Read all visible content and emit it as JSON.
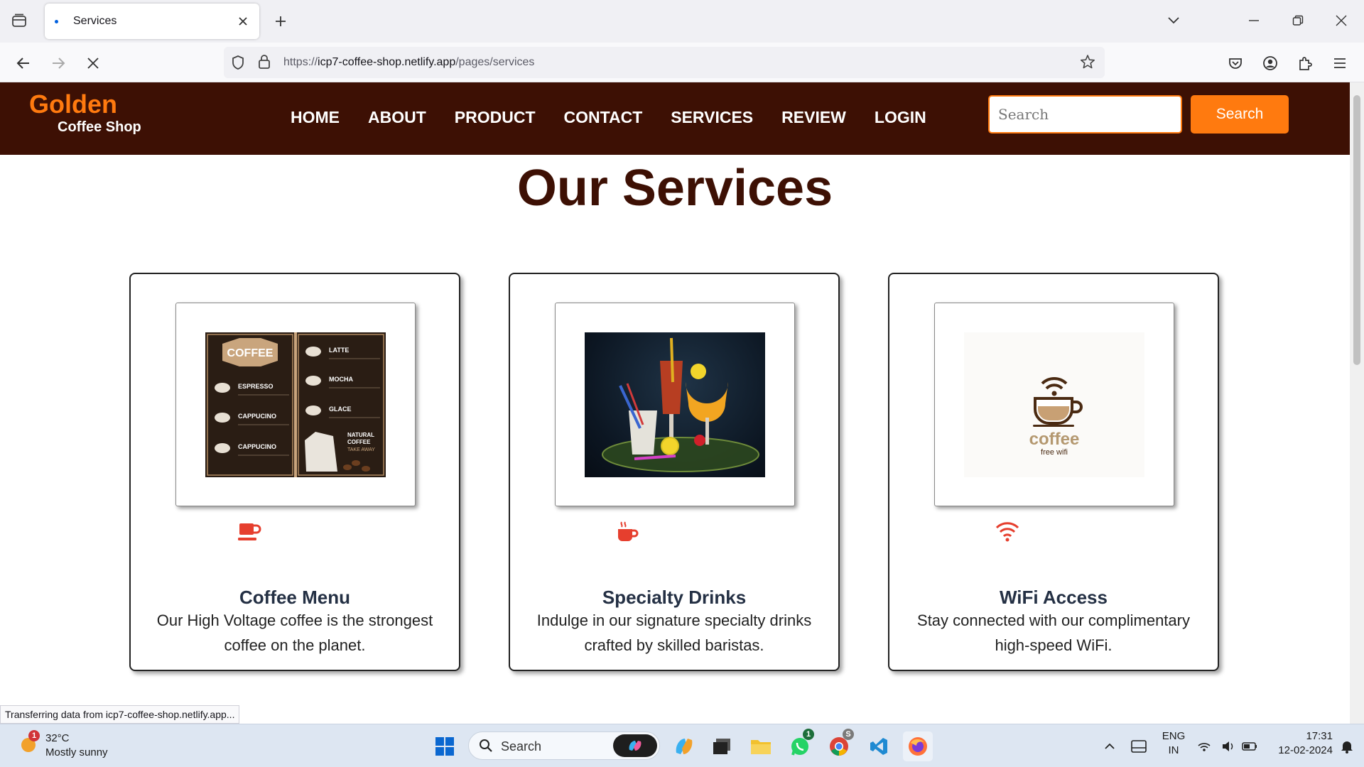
{
  "browser": {
    "tab_title": "Services",
    "url_scheme": "https://",
    "url_host": "icp7-coffee-shop.netlify.app",
    "url_path": "/pages/services",
    "status_text": "Transferring data from icp7-coffee-shop.netlify.app..."
  },
  "site": {
    "brand_line1": "Golden",
    "brand_line2": "Coffee Shop",
    "nav": [
      "HOME",
      "ABOUT",
      "PRODUCT",
      "CONTACT",
      "SERVICES",
      "REVIEW",
      "LOGIN"
    ],
    "search_placeholder": "Search",
    "search_button": "Search",
    "accent_color": "#ff7a0f",
    "header_color": "#3d1004"
  },
  "page": {
    "title": "Our Services",
    "services": [
      {
        "title": "Coffee Menu",
        "description": "Our High Voltage coffee is the strongest coffee on the planet.",
        "icon": "mug-icon",
        "menu_image": {
          "badge": "COFFEE",
          "left_items": [
            "ESPRESSO",
            "CAPPUCINO",
            "CAPPUCINO"
          ],
          "right_items": [
            "LATTE",
            "MOCHA",
            "GLACE"
          ],
          "promo_line1": "NATURAL",
          "promo_line2": "COFFEE",
          "promo_line3": "TAKE AWAY"
        }
      },
      {
        "title": "Specialty Drinks",
        "description": "Indulge in our signature specialty drinks crafted by skilled baristas.",
        "icon": "steaming-cup-icon"
      },
      {
        "title": "WiFi Access",
        "description": "Stay connected with our complimentary high-speed WiFi.",
        "icon": "wifi-icon",
        "logo_line1": "coffee",
        "logo_line2": "free wifi"
      }
    ]
  },
  "taskbar": {
    "weather_temp": "32°C",
    "weather_desc": "Mostly sunny",
    "weather_badge": "1",
    "search_label": "Search",
    "whatsapp_badge": "1",
    "chrome_badge": "S",
    "language_line1": "ENG",
    "language_line2": "IN",
    "time": "17:31",
    "date": "12-02-2024"
  }
}
